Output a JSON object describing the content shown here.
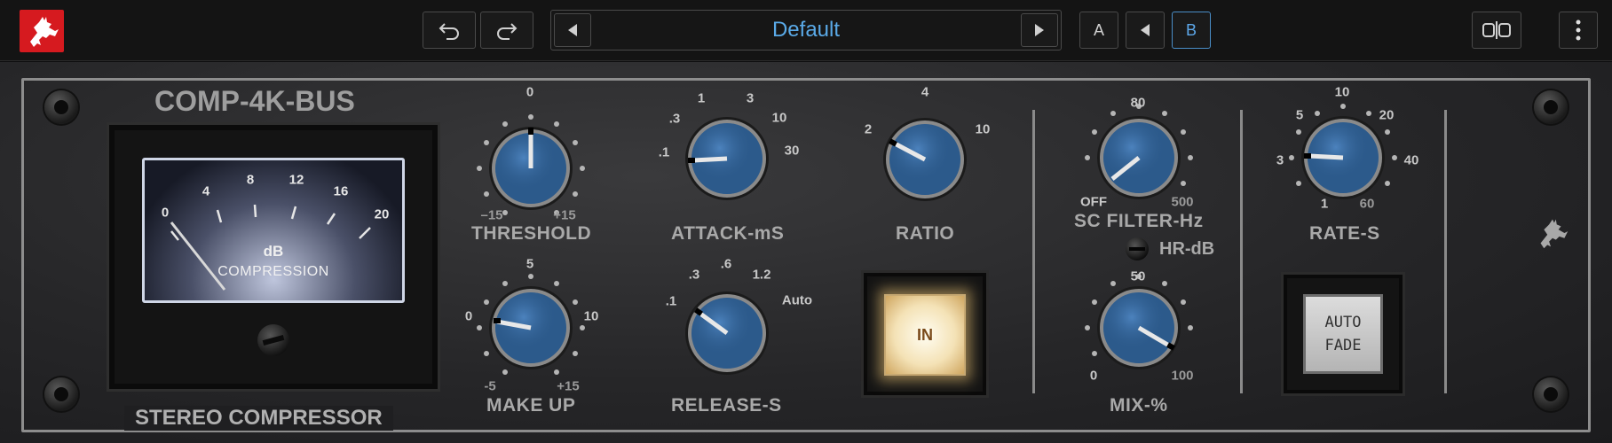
{
  "topbar": {
    "preset_name": "Default",
    "undo_icon": "undo-icon",
    "redo_icon": "redo-icon",
    "prev_icon": "triangle-left-icon",
    "next_icon": "triangle-right-icon",
    "ab_a": "A",
    "ab_b": "B",
    "ab_selected": "B",
    "accent": "#5aaae8",
    "logo_color": "#d61a1f"
  },
  "plugin": {
    "title": "COMP-4K-BUS",
    "subtitle": "STEREO COMPRESSOR",
    "meter": {
      "scale": [
        "0",
        "4",
        "8",
        "12",
        "16",
        "20"
      ],
      "unit": "dB",
      "caption": "COMPRESSION",
      "needle_value_db": 0
    },
    "threshold": {
      "label": "THRESHOLD",
      "top": "0",
      "min": "–15",
      "max": "+15",
      "value": 0
    },
    "makeup": {
      "label": "MAKE UP",
      "top": "5",
      "left": "0",
      "right": "10",
      "min": "-5",
      "max": "+15",
      "value": 0
    },
    "attack": {
      "label": "ATTACK-mS",
      "ticks": [
        ".1",
        ".3",
        "1",
        "3",
        "10",
        "30"
      ]
    },
    "release": {
      "label": "RELEASE-S",
      "ticks": [
        ".1",
        ".3",
        ".6",
        "1.2",
        "Auto"
      ]
    },
    "ratio": {
      "label": "RATIO",
      "ticks": [
        "2",
        "4",
        "10"
      ]
    },
    "in_button": {
      "label": "IN",
      "state": "on"
    },
    "sc_filter": {
      "label": "SC FILTER-Hz",
      "top": "80",
      "min": "OFF",
      "max": "500"
    },
    "hr_db": {
      "label": "HR-dB"
    },
    "mix": {
      "label": "MIX-%",
      "top": "50",
      "min": "0",
      "max": "100"
    },
    "rate": {
      "label": "RATE-S",
      "ticks": [
        "1",
        "3",
        "5",
        "10",
        "20",
        "40",
        "60"
      ]
    },
    "auto_fade": {
      "line1": "AUTO",
      "line2": "FADE"
    }
  }
}
